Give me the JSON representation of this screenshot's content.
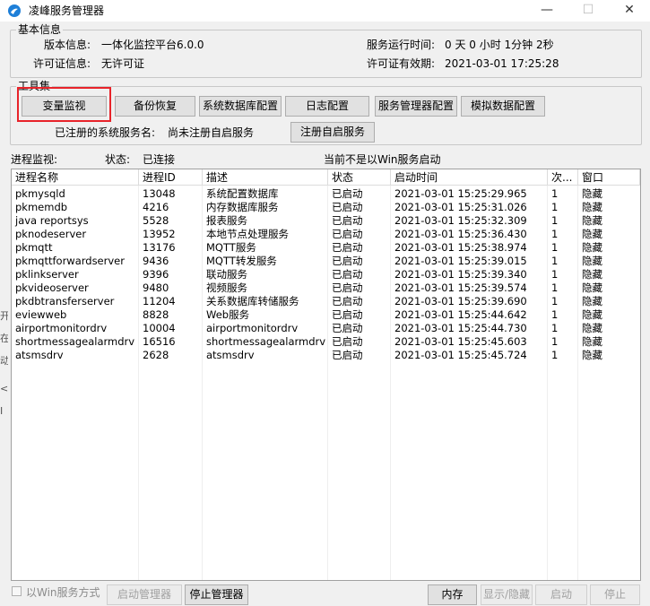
{
  "window": {
    "title": "凌峰服务管理器",
    "minimize_glyph": "—",
    "maximize_glyph": "☐",
    "close_glyph": "✕"
  },
  "left_strip": [
    "开",
    "在",
    "动",
    "<",
    "I"
  ],
  "basic_info": {
    "group_title": "基本信息",
    "version_label": "版本信息:",
    "version_value": "一体化监控平台6.0.0",
    "license_label": "许可证信息:",
    "license_value": "无许可证",
    "uptime_label": "服务运行时间:",
    "uptime_value": "0 天 0 小时 1分钟 2秒",
    "license_valid_label": "许可证有效期:",
    "license_valid_value": "2021-03-01 17:25:28"
  },
  "toolset": {
    "group_title": "工具集",
    "buttons": [
      "变量监视",
      "备份恢复",
      "系统数据库配置",
      "日志配置",
      "服务管理器配置",
      "模拟数据配置"
    ],
    "registered_label": "已注册的系统服务名:",
    "registered_value": "尚未注册自启服务",
    "register_button": "注册自启服务"
  },
  "process_monitor": {
    "title": "进程监视:",
    "status_label": "状态:",
    "status_value": "已连接",
    "mode_note": "当前不是以Win服务启动"
  },
  "table": {
    "columns": [
      "进程名称",
      "进程ID",
      "描述",
      "状态",
      "启动时间",
      "次...",
      "窗口"
    ],
    "rows": [
      [
        "pkmysqld",
        "13048",
        "系统配置数据库",
        "已启动",
        "2021-03-01 15:25:29.965",
        "1",
        "隐藏"
      ],
      [
        "pkmemdb",
        "4216",
        "内存数据库服务",
        "已启动",
        "2021-03-01 15:25:31.026",
        "1",
        "隐藏"
      ],
      [
        "java reportsys",
        "5528",
        "报表服务",
        "已启动",
        "2021-03-01 15:25:32.309",
        "1",
        "隐藏"
      ],
      [
        "pknodeserver",
        "13952",
        "本地节点处理服务",
        "已启动",
        "2021-03-01 15:25:36.430",
        "1",
        "隐藏"
      ],
      [
        "pkmqtt",
        "13176",
        "MQTT服务",
        "已启动",
        "2021-03-01 15:25:38.974",
        "1",
        "隐藏"
      ],
      [
        "pkmqttforwardserver",
        "9436",
        "MQTT转发服务",
        "已启动",
        "2021-03-01 15:25:39.015",
        "1",
        "隐藏"
      ],
      [
        "pklinkserver",
        "9396",
        "联动服务",
        "已启动",
        "2021-03-01 15:25:39.340",
        "1",
        "隐藏"
      ],
      [
        "pkvideoserver",
        "9480",
        "视频服务",
        "已启动",
        "2021-03-01 15:25:39.574",
        "1",
        "隐藏"
      ],
      [
        "pkdbtransferserver",
        "11204",
        "关系数据库转储服务",
        "已启动",
        "2021-03-01 15:25:39.690",
        "1",
        "隐藏"
      ],
      [
        "eviewweb",
        "8828",
        "Web服务",
        "已启动",
        "2021-03-01 15:25:44.642",
        "1",
        "隐藏"
      ],
      [
        "airportmonitordrv",
        "10004",
        "airportmonitordrv",
        "已启动",
        "2021-03-01 15:25:44.730",
        "1",
        "隐藏"
      ],
      [
        "shortmessagealarmdrv",
        "16516",
        "shortmessagealarmdrv",
        "已启动",
        "2021-03-01 15:25:45.603",
        "1",
        "隐藏"
      ],
      [
        "atsmsdrv",
        "2628",
        "atsmsdrv",
        "已启动",
        "2021-03-01 15:25:45.724",
        "1",
        "隐藏"
      ]
    ]
  },
  "bottom": {
    "win_service_checkbox_label": "以Win服务方式",
    "start_manager": "启动管理器",
    "stop_manager": "停止管理器",
    "memory": "内存",
    "show_hide": "显示/隐藏",
    "start": "启动",
    "stop": "停止"
  },
  "colors": {
    "highlight_border": "#e8232a",
    "window_bg": "#f0f0f0",
    "icon_blue": "#1e7fd8"
  }
}
